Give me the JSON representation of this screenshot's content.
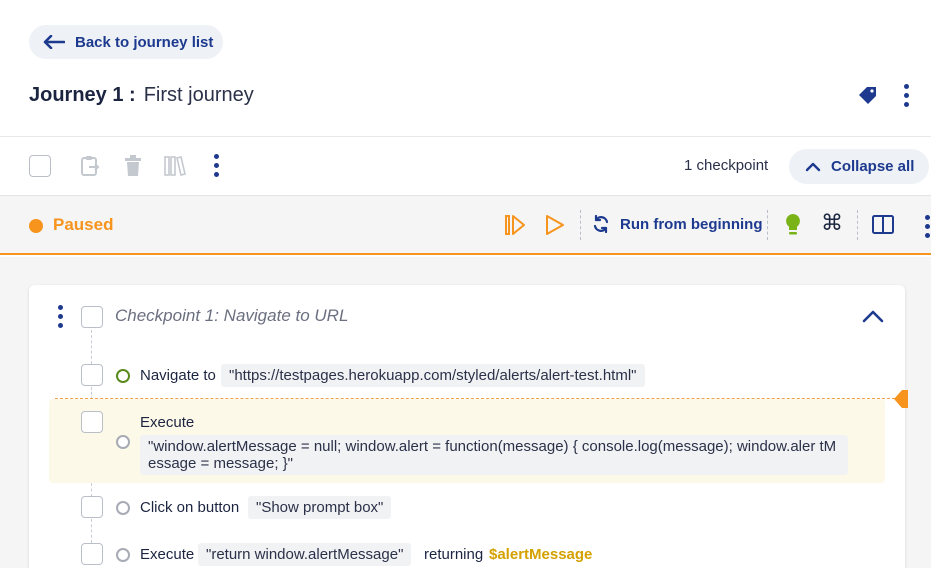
{
  "header": {
    "back_label": "Back to journey list",
    "journey_prefix": "Journey 1 :",
    "journey_name": "First journey"
  },
  "toolbar": {
    "checkpoint_count": "1 checkpoint",
    "collapse_label": "Collapse all"
  },
  "status": {
    "state": "Paused",
    "run_label": "Run from beginning"
  },
  "checkpoint": {
    "title": "Checkpoint 1:  Navigate to URL",
    "steps": [
      {
        "label": "Navigate to",
        "value": "\"https://testpages.herokuapp.com/styled/alerts/alert-test.html\""
      },
      {
        "label": "Execute",
        "value": "\"window.alertMessage = null; window.alert = function(message) { console.log(message); window.aler tMessage = message; }\""
      },
      {
        "label": "Click on button",
        "value": "\"Show prompt box\""
      },
      {
        "label": "Execute",
        "value": "\"return window.alertMessage\"",
        "suffix": "returning",
        "variable": "$alertMessage"
      }
    ]
  },
  "colors": {
    "primary": "#1d3a8f",
    "paused": "#f7941d",
    "active_step": "#5a8a1c",
    "variable": "#d4a100"
  }
}
